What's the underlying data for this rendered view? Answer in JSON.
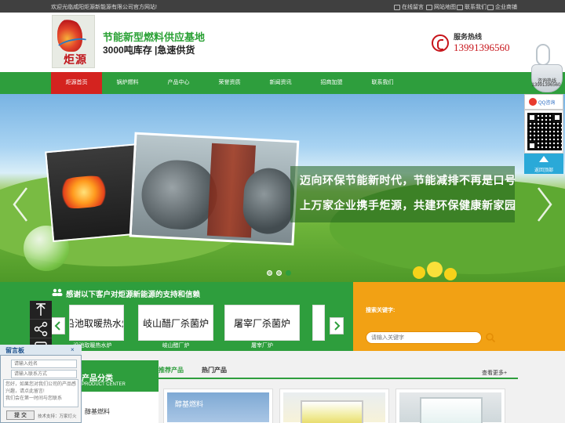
{
  "topbar": {
    "welcome": "欢迎光临咸阳炬源新能源有限公司官方网站!",
    "links": [
      {
        "label": "在线留言",
        "icon": "message-icon"
      },
      {
        "label": "网站地图",
        "icon": "sitemap-icon"
      },
      {
        "label": "联系我们",
        "icon": "phone-icon"
      },
      {
        "label": "企业商铺",
        "icon": "shop-icon"
      }
    ]
  },
  "header": {
    "logo_text": "炬源",
    "slogan_title": "节能新型燃料供应基地",
    "slogan_sub": "3000吨库存 |急速供货",
    "hotline_label": "服务热线",
    "hotline_number": "13991396560"
  },
  "nav": {
    "items": [
      "炬源首页",
      "锅炉燃料",
      "产品中心",
      "荣誉资质",
      "新闻资讯",
      "招商加盟",
      "联系我们"
    ],
    "active_index": 0
  },
  "banner": {
    "line1": "迈向环保节能新时代，节能减排不再是口号",
    "line2": "上万家企业携手炬源，共建环保健康新家园",
    "slides": 3,
    "active_slide": 0
  },
  "thanks": {
    "title": "感谢以下客户对炬源新能源的支持和信赖",
    "clients": [
      {
        "logo_text": "沿池取暖热水炉",
        "caption": "沿池取暖热水炉"
      },
      {
        "logo_text": "岐山醋厂杀菌炉",
        "caption": "岐山醋厂炉"
      },
      {
        "logo_text": "屠宰厂杀菌炉",
        "caption": "屠宰厂炉"
      },
      {
        "logo_text": "",
        "caption": ""
      }
    ]
  },
  "search": {
    "label": "搜索关键字:",
    "placeholder": "请输入关键字"
  },
  "categories": {
    "title": "产品分类",
    "subtitle": "PRODUCT CENTER",
    "first_item": "醇基燃料"
  },
  "products": {
    "tabs": [
      "推荐产品",
      "热门产品"
    ],
    "more": "查看更多+",
    "items": [
      {
        "label": "醇基燃料"
      },
      {
        "label": ""
      },
      {
        "label": ""
      }
    ]
  },
  "side_widget": {
    "hotline_label": "咨询热线",
    "hotline_number": "13991396560",
    "qq_label": "QQ咨询",
    "top_label": "返回顶部"
  },
  "message_board": {
    "title": "留言板",
    "close": "×",
    "name_placeholder": "请输入姓名",
    "contact_placeholder": "请输入联系方式",
    "content_placeholder": "您好，如果您对我们公司的产品感兴趣，请点此留言!\n我们会在第一时间与您联系",
    "submit": "提 交",
    "support": "技术支持：万家灯火"
  },
  "colors": {
    "brand_green": "#2e9e3d",
    "accent_red": "#d4231f",
    "search_orange": "#f2a114"
  }
}
